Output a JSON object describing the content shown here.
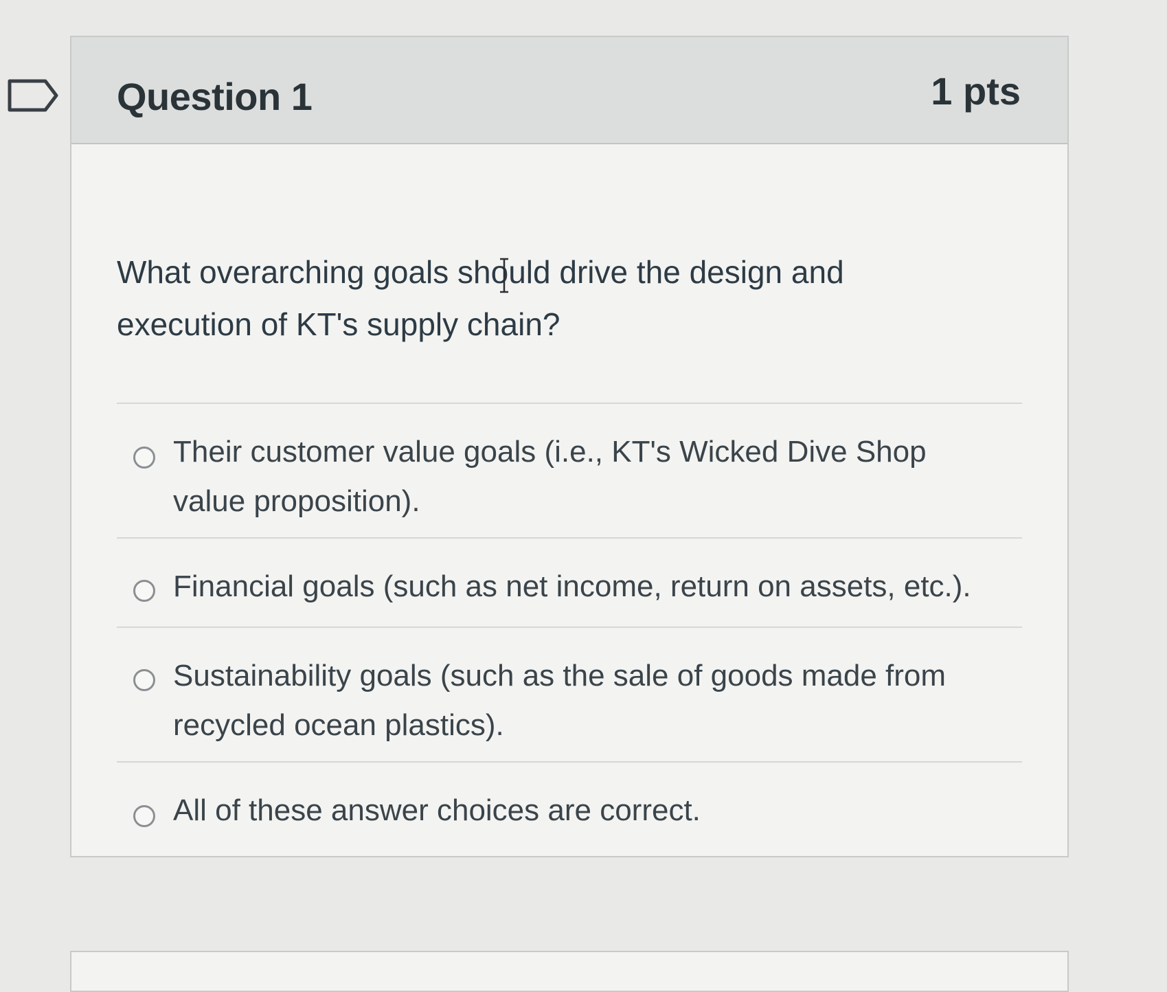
{
  "question": {
    "title": "Question 1",
    "points": "1 pts",
    "text": "What overarching goals should drive the design and execution of KT's supply chain?",
    "answers": [
      {
        "label": "Their customer value goals (i.e., KT's Wicked Dive Shop value proposition).",
        "selected": false
      },
      {
        "label": "Financial goals (such as net income, return on assets, etc.).",
        "selected": false
      },
      {
        "label": "Sustainability goals (such as the sale of goods made from recycled ocean plastics).",
        "selected": false
      },
      {
        "label": "All of these answer choices are correct.",
        "selected": false
      }
    ]
  },
  "icons": {
    "flag": "flag-question-icon",
    "cursor": "text-cursor-icon"
  },
  "colors": {
    "header_bg": "#dcdedd",
    "card_bg": "#f3f3f1",
    "text": "#2d3b45"
  }
}
